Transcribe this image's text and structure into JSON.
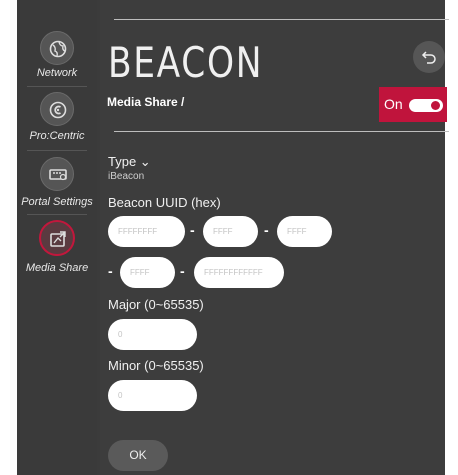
{
  "sidebar": {
    "items": [
      {
        "label": "Network",
        "icon": "network-globe-icon"
      },
      {
        "label": "Pro:Centric",
        "icon": "procentric-icon"
      },
      {
        "label": "Portal Settings",
        "icon": "portal-settings-icon"
      },
      {
        "label": "Media Share",
        "icon": "media-share-icon",
        "active": true
      }
    ]
  },
  "header": {
    "title": "BEACON",
    "breadcrumb": "Media Share /",
    "toggle_label": "On",
    "toggle_on": true
  },
  "form": {
    "type_label": "Type ⌄",
    "type_value": "iBeacon",
    "uuid_label": "Beacon UUID (hex)",
    "uuid_fields": [
      {
        "placeholder": "FFFFFFFF"
      },
      {
        "placeholder": "FFFF"
      },
      {
        "placeholder": "FFFF"
      },
      {
        "placeholder": "FFFF"
      },
      {
        "placeholder": "FFFFFFFFFFFF"
      }
    ],
    "separator": "-",
    "major_label": "Major (0~65535)",
    "major_placeholder": "0",
    "minor_label": "Minor (0~65535)",
    "minor_placeholder": "0",
    "ok_label": "OK"
  },
  "colors": {
    "accent": "#c0143c",
    "background": "#3d3d3d",
    "sidebar": "#3a3a3a"
  }
}
